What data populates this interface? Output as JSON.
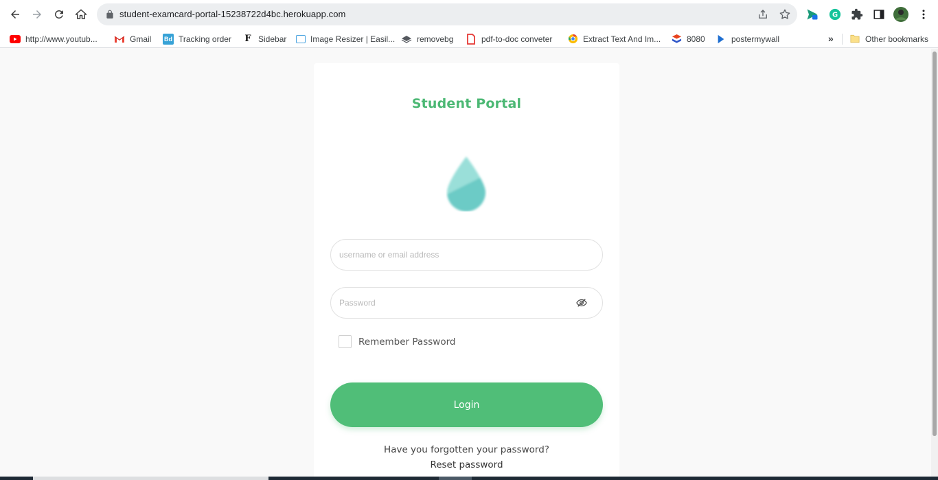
{
  "browser": {
    "url": "student-examcard-portal-15238722d4bc.herokuapp.com",
    "bookmarks": [
      {
        "label": "http://www.youtub...",
        "icon": "youtube-icon"
      },
      {
        "label": "Gmail",
        "icon": "gmail-icon"
      },
      {
        "label": "Tracking order",
        "icon": "bd-icon"
      },
      {
        "label": "Sidebar",
        "icon": "f-icon"
      },
      {
        "label": "Image Resizer | Easil...",
        "icon": "image-resizer-icon"
      },
      {
        "label": "removebg",
        "icon": "layers-icon"
      },
      {
        "label": "pdf-to-doc conveter",
        "icon": "pdf-icon"
      },
      {
        "label": "Extract Text And Im...",
        "icon": "chrome-icon"
      },
      {
        "label": "8080",
        "icon": "stack-icon"
      },
      {
        "label": "postermywall",
        "icon": "postermywall-icon"
      }
    ],
    "overflow": "»",
    "other_bookmarks": "Other bookmarks"
  },
  "portal": {
    "title": "Student Portal",
    "username_placeholder": "username or email address",
    "password_placeholder": "Password",
    "remember_label": "Remember Password",
    "login_label": "Login",
    "forgot_text": "Have you forgotten your password?",
    "reset_link": "Reset password"
  },
  "colors": {
    "accent": "#50be78",
    "title": "#4cb874",
    "drop_light": "#9adfd9",
    "drop_dark": "#6ccbc6"
  }
}
